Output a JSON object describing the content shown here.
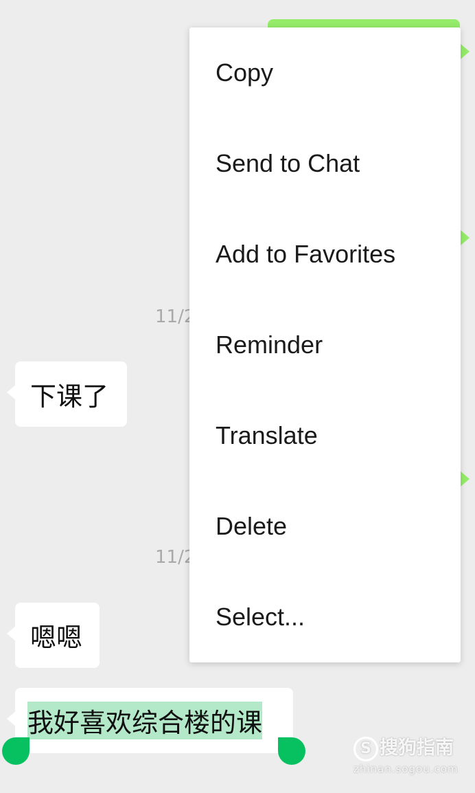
{
  "chat": {
    "timestamp_1": "11/2",
    "timestamp_2": "11/2",
    "message_1": "下课了",
    "message_2": "嗯嗯",
    "message_3": "我好喜欢综合楼的课"
  },
  "context_menu": {
    "items": [
      {
        "label": "Copy"
      },
      {
        "label": "Send to Chat"
      },
      {
        "label": "Add to Favorites"
      },
      {
        "label": "Reminder"
      },
      {
        "label": "Translate"
      },
      {
        "label": "Delete"
      },
      {
        "label": "Select..."
      }
    ]
  },
  "watermark": {
    "brand": "搜狗指南",
    "icon_letter": "S",
    "url": "zhinan.sogou.com"
  },
  "colors": {
    "sent_bubble": "#95ec69",
    "selection_handle": "#07c160",
    "selection_highlight": "#b3e8c8",
    "background": "#ededed"
  }
}
